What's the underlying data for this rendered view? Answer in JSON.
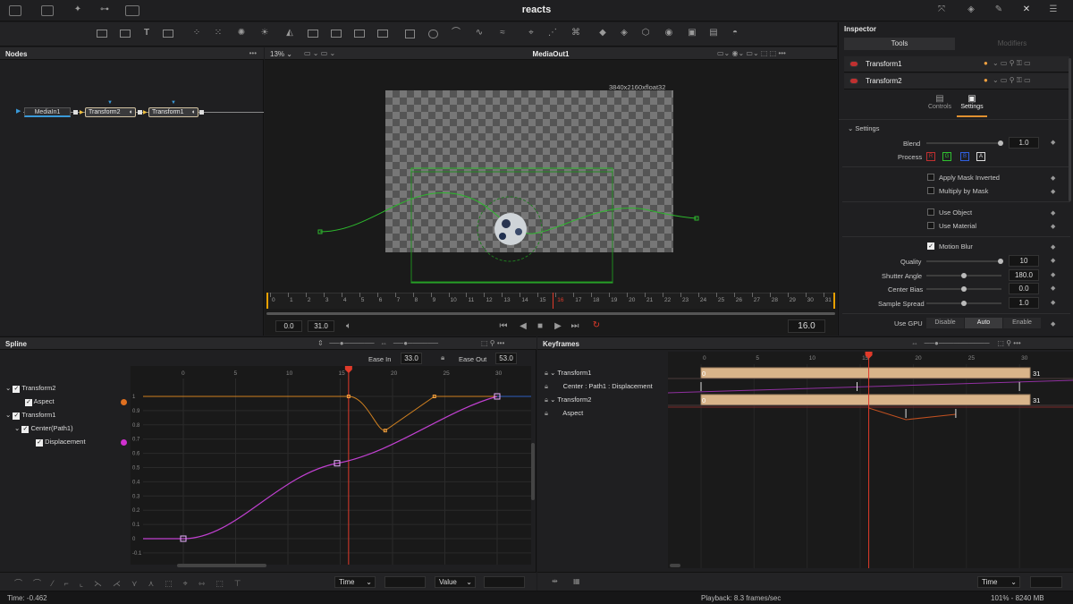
{
  "title": "reacts",
  "panels": {
    "nodes": "Nodes",
    "viewer": "MediaOut1",
    "inspector": "Inspector",
    "spline": "Spline",
    "keyframes": "Keyframes"
  },
  "node_graph": {
    "nodes": [
      "MediaIn1",
      "Transform2",
      "Transform1"
    ]
  },
  "viewer": {
    "zoom": "13%",
    "resolution": "3840x2160xfloat32",
    "start_frame": "0.0",
    "end_frame": "31.0",
    "current_frame": "16.0",
    "ruler_ticks": [
      "0",
      "1",
      "2",
      "3",
      "4",
      "5",
      "6",
      "7",
      "8",
      "9",
      "10",
      "11",
      "12",
      "13",
      "14",
      "15",
      "16",
      "17",
      "18",
      "19",
      "20",
      "21",
      "22",
      "23",
      "24",
      "25",
      "26",
      "27",
      "28",
      "29",
      "30",
      "31"
    ]
  },
  "inspector": {
    "tabs": [
      "Tools",
      "Modifiers"
    ],
    "tools": [
      "Transform1",
      "Transform2"
    ],
    "subtabs": [
      "Controls",
      "Settings"
    ],
    "section": "Settings",
    "blend": {
      "label": "Blend",
      "value": "1.0",
      "level": 1.0
    },
    "process": {
      "label": "Process",
      "channels": [
        "R",
        "G",
        "B",
        "A"
      ]
    },
    "apply_mask_inverted": "Apply Mask Inverted",
    "multiply_by_mask": "Multiply by Mask",
    "use_object": "Use Object",
    "use_material": "Use Material",
    "motion_blur": "Motion Blur",
    "quality": {
      "label": "Quality",
      "value": "10",
      "level": 1.0
    },
    "shutter_angle": {
      "label": "Shutter Angle",
      "value": "180.0",
      "level": 0.5
    },
    "center_bias": {
      "label": "Center Bias",
      "value": "0.0",
      "level": 0.5
    },
    "sample_spread": {
      "label": "Sample Spread",
      "value": "1.0",
      "level": 0.5
    },
    "use_gpu": {
      "label": "Use GPU",
      "options": [
        "Disable",
        "Auto",
        "Enable"
      ],
      "selected": "Auto"
    }
  },
  "spline": {
    "ease_in_label": "Ease In",
    "ease_in": "33.0",
    "ease_out_label": "Ease Out",
    "ease_out": "53.0",
    "tree": [
      "Transform2",
      "Aspect",
      "Transform1",
      "Center(Path1)",
      "Displacement"
    ],
    "x_ticks": [
      "0",
      "5",
      "10",
      "15",
      "20",
      "25",
      "30"
    ],
    "y_ticks": [
      "1",
      "0.9",
      "0.8",
      "0.7",
      "0.6",
      "0.5",
      "0.4",
      "0.3",
      "0.2",
      "0.1",
      "0",
      "-0.1"
    ],
    "bottom_time": "Time",
    "bottom_value": "Value",
    "status": "Time: -0.462"
  },
  "keyframes": {
    "rows": [
      "Transform1",
      "Center : Path1 : Displacement",
      "Transform2",
      "Aspect"
    ],
    "x_ticks": [
      "0",
      "5",
      "10",
      "15",
      "20",
      "25",
      "30"
    ],
    "bar_start": "0",
    "bar_end": "31",
    "bottom_time": "Time",
    "status_playback": "Playback: 8.3 frames/sec",
    "status_mem": "101% - 8240 MB"
  },
  "colors": {
    "accent_orange": "#f0a040",
    "curve_magenta": "#c040d0",
    "curve_orange": "#d08020",
    "playhead": "#e03a2a",
    "path_green": "#2db82d"
  }
}
